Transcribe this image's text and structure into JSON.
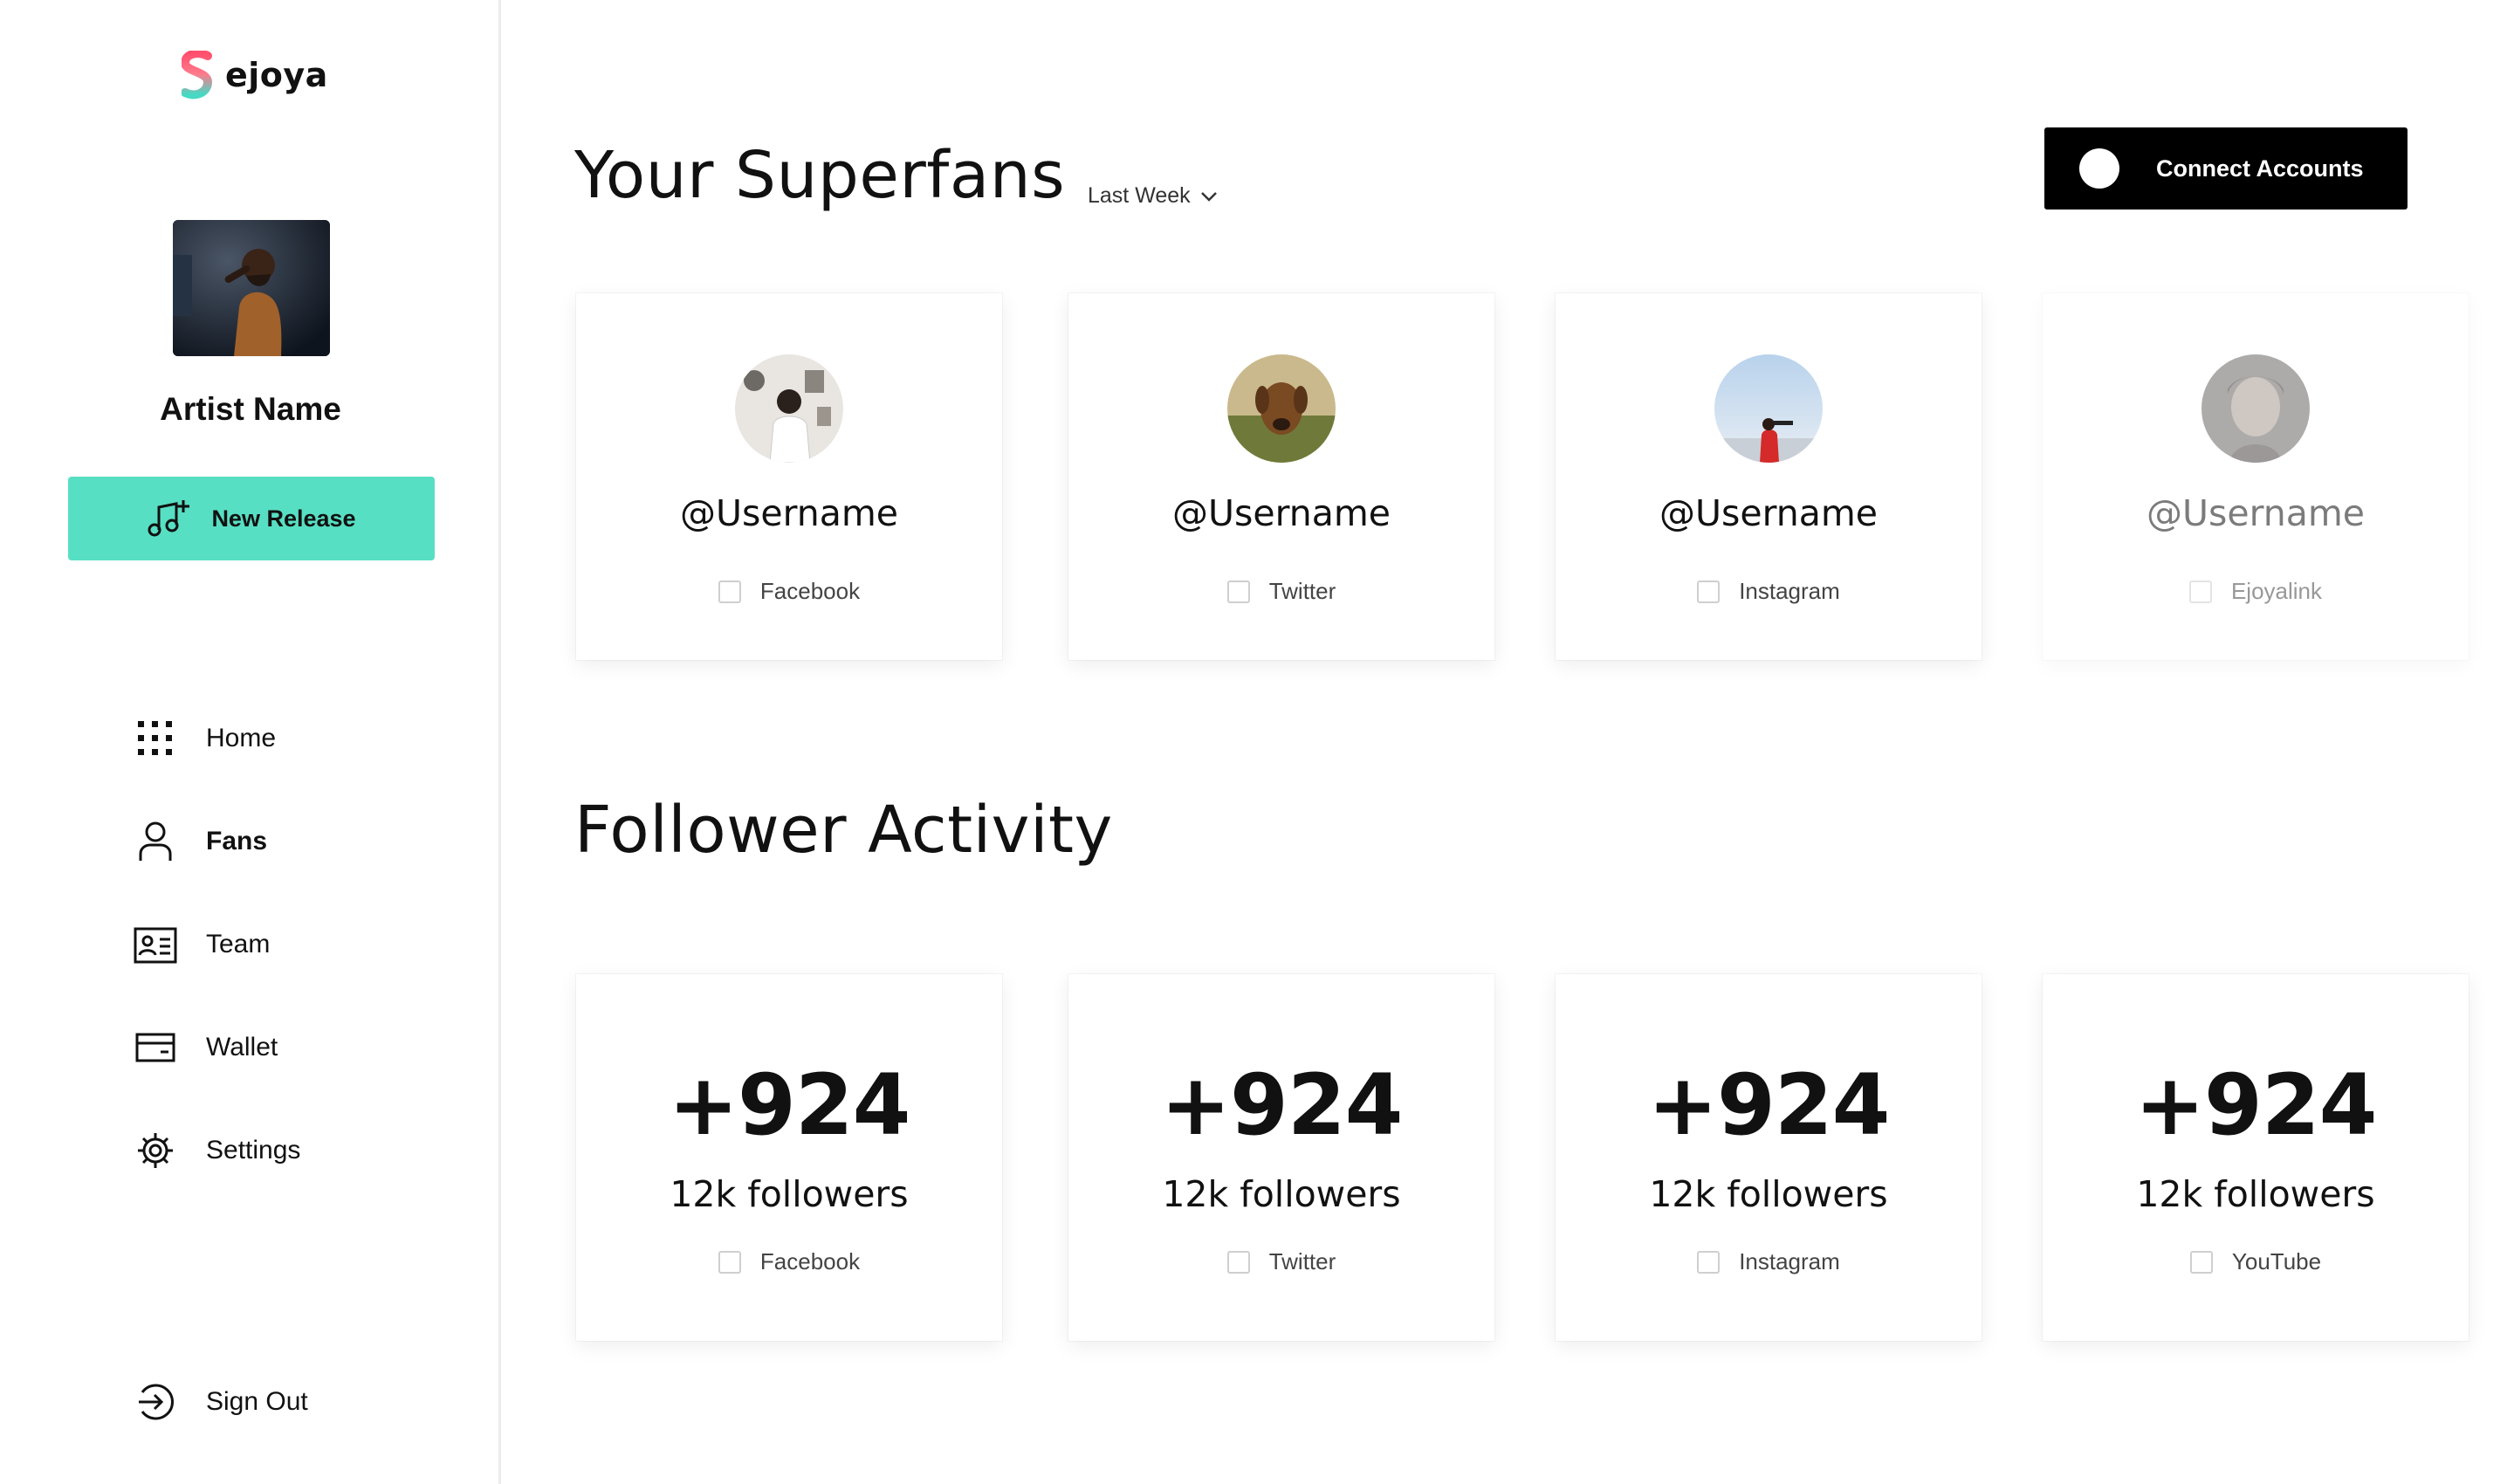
{
  "brand": {
    "name": "ejoya"
  },
  "sidebar": {
    "artist_name": "Artist Name",
    "new_release_label": "New Release",
    "nav": [
      {
        "label": "Home",
        "icon": "grid-icon"
      },
      {
        "label": "Fans",
        "icon": "user-icon",
        "active": true
      },
      {
        "label": "Team",
        "icon": "contact-card-icon"
      },
      {
        "label": "Wallet",
        "icon": "wallet-icon"
      },
      {
        "label": "Settings",
        "icon": "gear-icon"
      }
    ],
    "sign_out_label": "Sign Out"
  },
  "superfans": {
    "title": "Your Superfans",
    "period": "Last Week",
    "connect_label": "Connect Accounts",
    "cards": [
      {
        "username": "@Username",
        "platform": "Facebook"
      },
      {
        "username": "@Username",
        "platform": "Twitter"
      },
      {
        "username": "@Username",
        "platform": "Instagram"
      },
      {
        "username": "@Username",
        "platform": "Ejoyalink"
      }
    ]
  },
  "activity": {
    "title": "Follower Activity",
    "cards": [
      {
        "delta": "+924",
        "followers": "12k followers",
        "platform": "Facebook"
      },
      {
        "delta": "+924",
        "followers": "12k followers",
        "platform": "Twitter"
      },
      {
        "delta": "+924",
        "followers": "12k followers",
        "platform": "Instagram"
      },
      {
        "delta": "+924",
        "followers": "12k followers",
        "platform": "YouTube"
      }
    ]
  },
  "colors": {
    "accent": "#57dfc3",
    "button_dark": "#000000",
    "divider": "#ececec"
  }
}
